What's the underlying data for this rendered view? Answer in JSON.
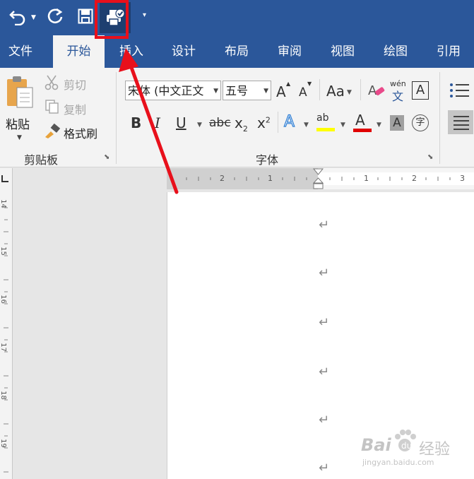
{
  "tabs": [
    {
      "label": "文件",
      "active": false
    },
    {
      "label": "开始",
      "active": true
    },
    {
      "label": "插入",
      "active": false
    },
    {
      "label": "设计",
      "active": false
    },
    {
      "label": "布局",
      "active": false
    },
    {
      "label": "审阅",
      "active": false
    },
    {
      "label": "视图",
      "active": false
    },
    {
      "label": "绘图",
      "active": false
    },
    {
      "label": "引用",
      "active": false
    }
  ],
  "clipboard": {
    "paste_label": "粘贴",
    "cut_label": "剪切",
    "copy_label": "复制",
    "format_painter_label": "格式刷",
    "group_label": "剪贴板"
  },
  "font": {
    "font_name": "宋体 (中文正文",
    "font_size": "五号",
    "group_label": "字体",
    "grow_font": "A",
    "shrink_font": "A",
    "change_case": "Aa",
    "phonetic_top": "wén",
    "phonetic_bottom": "文",
    "char_border": "A",
    "bold": "B",
    "italic": "I",
    "underline": "U",
    "strikethrough": "abc",
    "subscript": "x",
    "subscript_mark": "2",
    "superscript": "x",
    "superscript_mark": "2",
    "text_effects": "A",
    "highlight": "ab",
    "font_color": "A",
    "char_shading": "A",
    "enclose_char": "字"
  },
  "ruler_labels": [
    "2",
    "1",
    "1",
    "2",
    "3"
  ],
  "vruler_labels": [
    "14",
    "15",
    "16",
    "17",
    "18",
    "19"
  ],
  "paragraph_mark": "↵",
  "paragraph_count": 6,
  "watermark": {
    "brand": "Bai",
    "brand2": "经验",
    "url": "jingyan.baidu.com"
  },
  "colors": {
    "ribbon_blue": "#2b579a",
    "highlight_yellow": "#ffff00",
    "font_red": "#e00000",
    "annotation_red": "#e8101b"
  }
}
